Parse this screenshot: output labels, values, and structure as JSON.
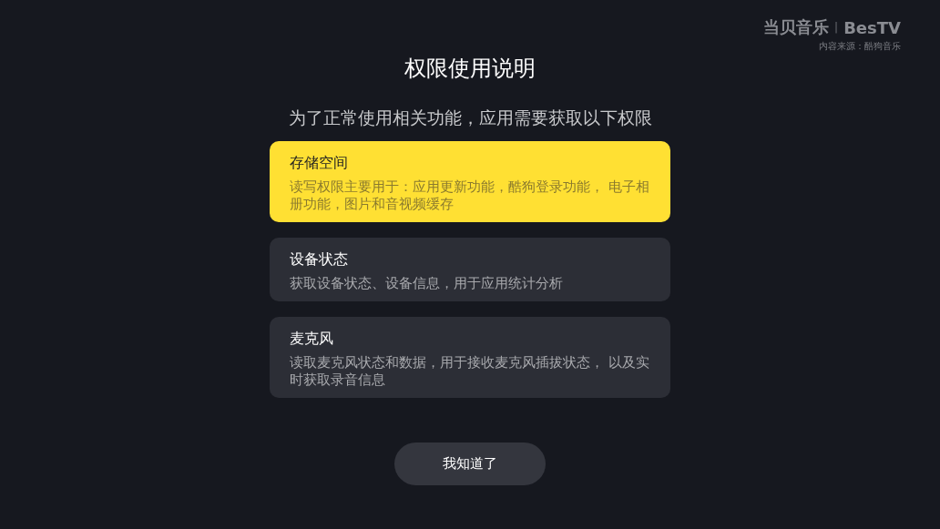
{
  "brand": {
    "logo": "当贝音乐",
    "separator": "|",
    "partner": "BesTV",
    "source": "内容来源：酷狗音乐"
  },
  "title": "权限使用说明",
  "subtitle": "为了正常使用相关功能，应用需要获取以下权限",
  "permissions": [
    {
      "name": "存储空间",
      "description": "读写权限主要用于：应用更新功能，酷狗登录功能， 电子相册功能，图片和音视频缓存",
      "selected": true
    },
    {
      "name": "设备状态",
      "description": "获取设备状态、设备信息，用于应用统计分析",
      "selected": false
    },
    {
      "name": "麦克风",
      "description": "读取麦克风状态和数据，用于接收麦克风插拔状态， 以及实时获取录音信息",
      "selected": false
    }
  ],
  "button": "我知道了"
}
